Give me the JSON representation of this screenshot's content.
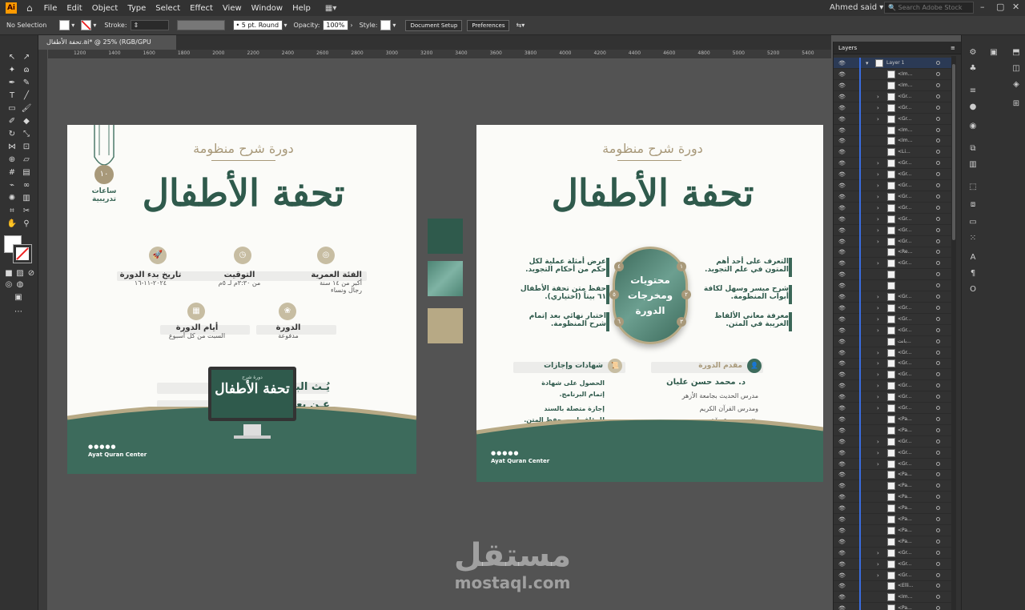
{
  "app": {
    "logo": "Ai",
    "menu": [
      "File",
      "Edit",
      "Object",
      "Type",
      "Select",
      "Effect",
      "View",
      "Window",
      "Help"
    ],
    "user": "Ahmed said",
    "search_placeholder": "Search Adobe Stock"
  },
  "control": {
    "selection": "No Selection",
    "stroke_label": "Stroke:",
    "brush": "5 pt. Round",
    "opacity_label": "Opacity:",
    "opacity_value": "100%",
    "style_label": "Style:",
    "doc_setup": "Document Setup",
    "preferences": "Preferences"
  },
  "document": {
    "tab_title": "تحفة الأطفال.ai* @ 25% (RGB/GPU Preview)",
    "close": "×"
  },
  "ruler": [
    "1200",
    "1400",
    "1600",
    "1800",
    "2000",
    "2200",
    "2400",
    "2600",
    "2800",
    "3000",
    "3200",
    "3400",
    "3600",
    "3800",
    "4000",
    "4200",
    "4400",
    "4600",
    "4800",
    "5000",
    "5200",
    "5400"
  ],
  "board1": {
    "subtitle": "دورة شرح منظومة",
    "title": "تحفة الأطفال",
    "hours_num": "١٠",
    "hours_label": "ساعات تدريبية",
    "age_title": "الفئة العمرية",
    "age_text": "أكبر من ١٤ سنة",
    "age_sub": "رجال ونساء",
    "time_title": "التوقيت",
    "time_text": "من ٣:٣٠م لـ ٥م",
    "date_title": "تاريخ بدء الدورة",
    "date_text": "٢٠٢٤-١١-١٦",
    "fee_title": "الدورة",
    "fee_text": "مدفوعة",
    "days_title": "أيام الدورة",
    "days_text": "السبت من كل أسبوع",
    "remote_line1": "يُـث البرنامج",
    "remote_line2": "عـن بعـد",
    "screen_sub": "دورة شرح",
    "screen_title": "تحفة الأطفال",
    "footer": "Ayat Quran Center"
  },
  "board2": {
    "subtitle": "دورة شرح منظومة",
    "title": "تحفة الأطفال",
    "oval": "محتويات ومخرجات الدورة",
    "items_right": [
      {
        "num": "١",
        "line1": "التعرف على أحد أهم",
        "line2": "المتون في علم التجويد."
      },
      {
        "num": "٢",
        "line1": "شرح ميسر وسهل لكافة",
        "line2": "أبواب المنظومة."
      },
      {
        "num": "٣",
        "line1": "معرفة معاني الألفاظ",
        "line2": "الغريبة في المتن."
      }
    ],
    "items_left": [
      {
        "num": "٤",
        "line1": "عرض أمثلة عملية لكل",
        "line2": "حكم من أحكام التجويد."
      },
      {
        "num": "٥",
        "line1": "حفظ متن تحفة الأطفال",
        "line2": "٦١ بيتاً (اختياري)."
      },
      {
        "num": "٦",
        "line1": "اختبار نهائي بعد إتمام",
        "line2": "شرح المنظومة."
      }
    ],
    "presenter_title": "مقدم الدورة",
    "presenter_name": "د. محمد حسن عليان",
    "presenter_l1": "مدرس الحديث بجامعة الأزهر",
    "presenter_l2": "ومدرس القرآن الكريم",
    "presenter_l3": "والتجويد بمركز آيات",
    "cert_title": "شهادات وإجازات",
    "cert_l1": "الحصول على شهادة",
    "cert_l2": "إتمام البرنامج.",
    "cert_l3": "إجازة متصلة بالسند",
    "cert_l4": "للمؤلف لمن يحفظ المتن.",
    "footer": "Ayat Quran Center"
  },
  "colors": {
    "green": "#2f5a4c",
    "teal": "#5f8f80",
    "gold": "#b7a985"
  },
  "layers": {
    "panel_title": "Layers",
    "top_layer": "Layer 1",
    "rows": [
      "<Im...",
      "<Im...",
      "<Gr...",
      "<Gr...",
      "<Gr...",
      "<Im...",
      "<Im...",
      "<Li...",
      "<Gr...",
      "<Gr...",
      "<Gr...",
      "<Gr...",
      "<Gr...",
      "<Gr...",
      "<Gr...",
      "<Gr...",
      "<Re...",
      "<Gr...",
      "",
      "",
      "<Gr...",
      "<Gr...",
      "<Gr...",
      "<Gr...",
      "بانت...",
      "<Gr...",
      "<Gr...",
      "<Gr...",
      "<Gr...",
      "<Gr...",
      "<Gr...",
      "<Pa...",
      "<Pa...",
      "<Gr...",
      "<Gr...",
      "<Gr...",
      "<Pa...",
      "<Pa...",
      "<Pa...",
      "<Pa...",
      "<Pa...",
      "<Pa...",
      "<Pa...",
      "<Gr...",
      "<Gr...",
      "<Gr...",
      "<Elli...",
      "<Im...",
      "<Pa..."
    ]
  },
  "watermark": {
    "ar": "مستقل",
    "en": "mostaql.com"
  }
}
